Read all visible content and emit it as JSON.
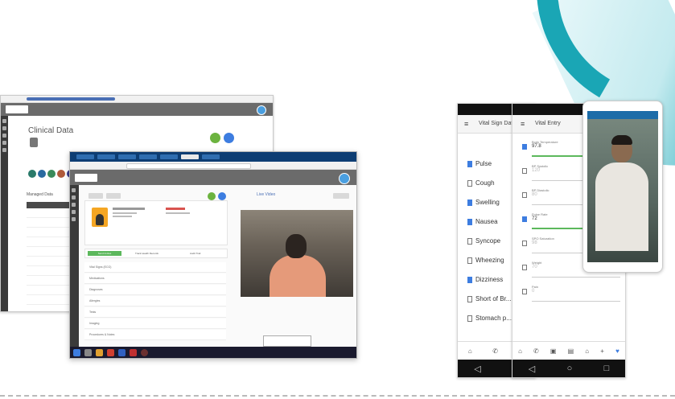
{
  "desktop_back": {
    "page_title": "Clinical Data",
    "table_title": "Managed Data",
    "table_rows": [
      "",
      "",
      "",
      "",
      "",
      "",
      "",
      "",
      "",
      ""
    ]
  },
  "desktop_front": {
    "section_label": "Live Video",
    "green_button": "Send Invites",
    "tab_2": "Track Health Records",
    "tab_3": "Audit Trail",
    "list_items": [
      "Vital Signs (ECG)",
      "Medications",
      "Diagnoses",
      "Allergies",
      "Tests",
      "Imaging",
      "Procedures & Notes"
    ]
  },
  "phone_left": {
    "header_title": "Vital Sign Data",
    "items": [
      {
        "label": "Pulse",
        "checked": true
      },
      {
        "label": "Cough",
        "checked": false
      },
      {
        "label": "Swelling",
        "checked": true
      },
      {
        "label": "Nausea",
        "checked": true
      },
      {
        "label": "Syncope",
        "checked": false
      },
      {
        "label": "Wheezing",
        "checked": false
      },
      {
        "label": "Dizziness",
        "checked": true
      },
      {
        "label": "Short of Br...",
        "checked": false
      },
      {
        "label": "Stomach p...",
        "checked": false
      }
    ]
  },
  "phone_mid": {
    "header_title": "Vital Entry",
    "fields": [
      {
        "label": "Body Temperature",
        "value": "97.8",
        "checked": true
      },
      {
        "label": "BP Systolic",
        "value": "120",
        "checked": false
      },
      {
        "label": "BP Diastolic",
        "value": "80",
        "checked": false
      },
      {
        "label": "Pulse Rate",
        "value": "72",
        "checked": true
      },
      {
        "label": "SPO Saturation",
        "value": "98",
        "checked": false
      },
      {
        "label": "Weight",
        "value": "70",
        "checked": false
      },
      {
        "label": "Pain",
        "value": "0",
        "checked": false
      }
    ]
  },
  "colors": {
    "accent": "#1aa6b5",
    "blue": "#3d7de0",
    "green": "#5cb85c",
    "header_gray": "#6b6b6b"
  }
}
